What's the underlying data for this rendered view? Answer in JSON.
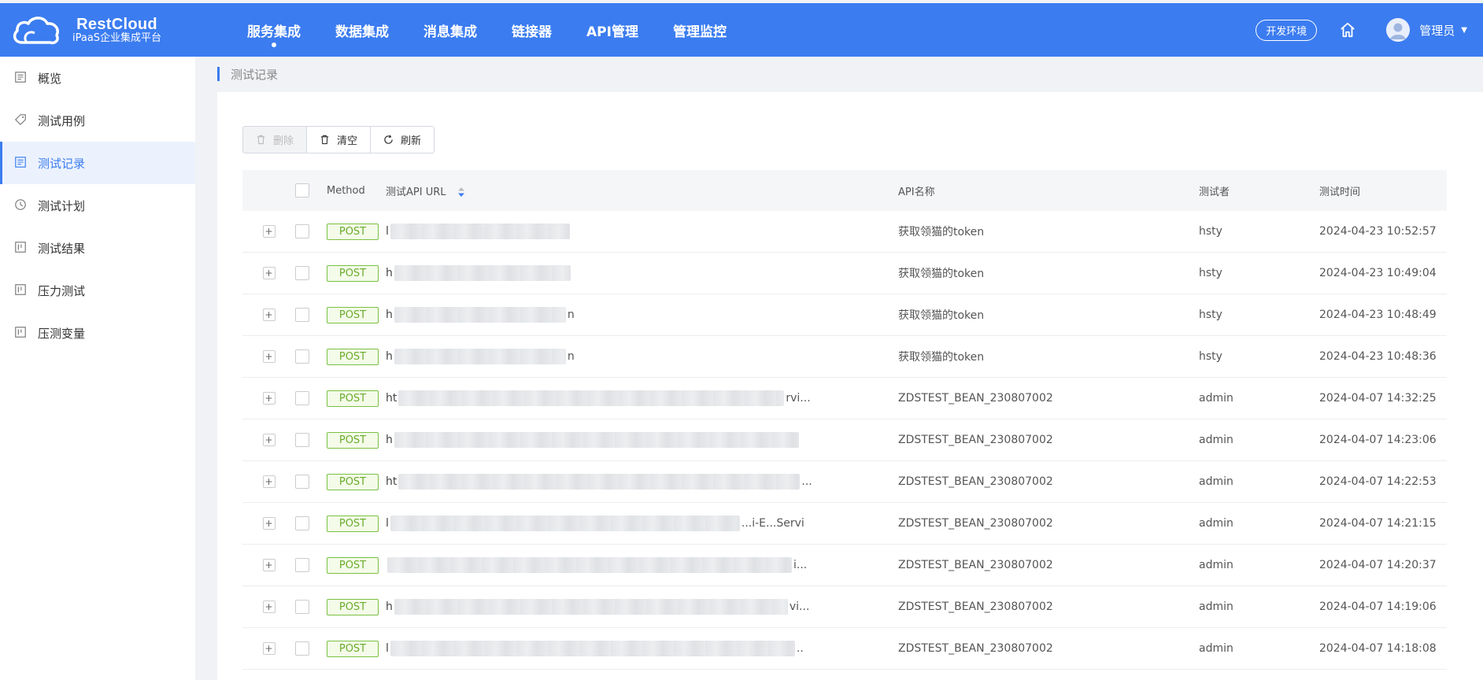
{
  "brand": {
    "title": "RestCloud",
    "subtitle": "iPaaS企业集成平台"
  },
  "nav": [
    {
      "label": "服务集成",
      "active": true
    },
    {
      "label": "数据集成",
      "active": false
    },
    {
      "label": "消息集成",
      "active": false
    },
    {
      "label": "链接器",
      "active": false
    },
    {
      "label": "API管理",
      "active": false
    },
    {
      "label": "管理监控",
      "active": false
    }
  ],
  "header": {
    "env": "开发环境",
    "user": "管理员"
  },
  "sidebar": [
    {
      "label": "概览",
      "icon": "overview-icon",
      "active": false
    },
    {
      "label": "测试用例",
      "icon": "tag-icon",
      "active": false
    },
    {
      "label": "测试记录",
      "icon": "list-icon",
      "active": true
    },
    {
      "label": "测试计划",
      "icon": "clock-icon",
      "active": false
    },
    {
      "label": "测试结果",
      "icon": "board-icon",
      "active": false
    },
    {
      "label": "压力测试",
      "icon": "board-icon",
      "active": false
    },
    {
      "label": "压测变量",
      "icon": "board-icon",
      "active": false
    }
  ],
  "breadcrumb": "测试记录",
  "toolbar": {
    "delete": "删除",
    "clear": "清空",
    "refresh": "刷新"
  },
  "table": {
    "columns": {
      "method": "Method",
      "url": "测试API URL",
      "name": "API名称",
      "tester": "测试者",
      "time": "测试时间"
    },
    "rows": [
      {
        "method": "POST",
        "url_lead": "l",
        "url_tail": "",
        "name": "获取领猫的token",
        "tester": "hsty",
        "time": "2024-04-23 10:52:57"
      },
      {
        "method": "POST",
        "url_lead": "h",
        "url_tail": "",
        "name": "获取领猫的token",
        "tester": "hsty",
        "time": "2024-04-23 10:49:04"
      },
      {
        "method": "POST",
        "url_lead": "h",
        "url_tail": "n",
        "name": "获取领猫的token",
        "tester": "hsty",
        "time": "2024-04-23 10:48:49"
      },
      {
        "method": "POST",
        "url_lead": "h",
        "url_tail": "n",
        "name": "获取领猫的token",
        "tester": "hsty",
        "time": "2024-04-23 10:48:36"
      },
      {
        "method": "POST",
        "url_lead": "ht",
        "url_tail": "rvi...",
        "name": "ZDSTEST_BEAN_230807002",
        "tester": "admin",
        "time": "2024-04-07 14:32:25"
      },
      {
        "method": "POST",
        "url_lead": "h",
        "url_tail": "",
        "name": "ZDSTEST_BEAN_230807002",
        "tester": "admin",
        "time": "2024-04-07 14:23:06"
      },
      {
        "method": "POST",
        "url_lead": "ht",
        "url_tail": "...",
        "name": "ZDSTEST_BEAN_230807002",
        "tester": "admin",
        "time": "2024-04-07 14:22:53"
      },
      {
        "method": "POST",
        "url_lead": "l",
        "url_tail": "...i-E...Servi",
        "name": "ZDSTEST_BEAN_230807002",
        "tester": "admin",
        "time": "2024-04-07 14:21:15"
      },
      {
        "method": "POST",
        "url_lead": "",
        "url_tail": "i...",
        "name": "ZDSTEST_BEAN_230807002",
        "tester": "admin",
        "time": "2024-04-07 14:20:37"
      },
      {
        "method": "POST",
        "url_lead": "h",
        "url_tail": "vi...",
        "name": "ZDSTEST_BEAN_230807002",
        "tester": "admin",
        "time": "2024-04-07 14:19:06"
      },
      {
        "method": "POST",
        "url_lead": "l",
        "url_tail": "..",
        "name": "ZDSTEST_BEAN_230807002",
        "tester": "admin",
        "time": "2024-04-07 14:18:08"
      }
    ]
  }
}
